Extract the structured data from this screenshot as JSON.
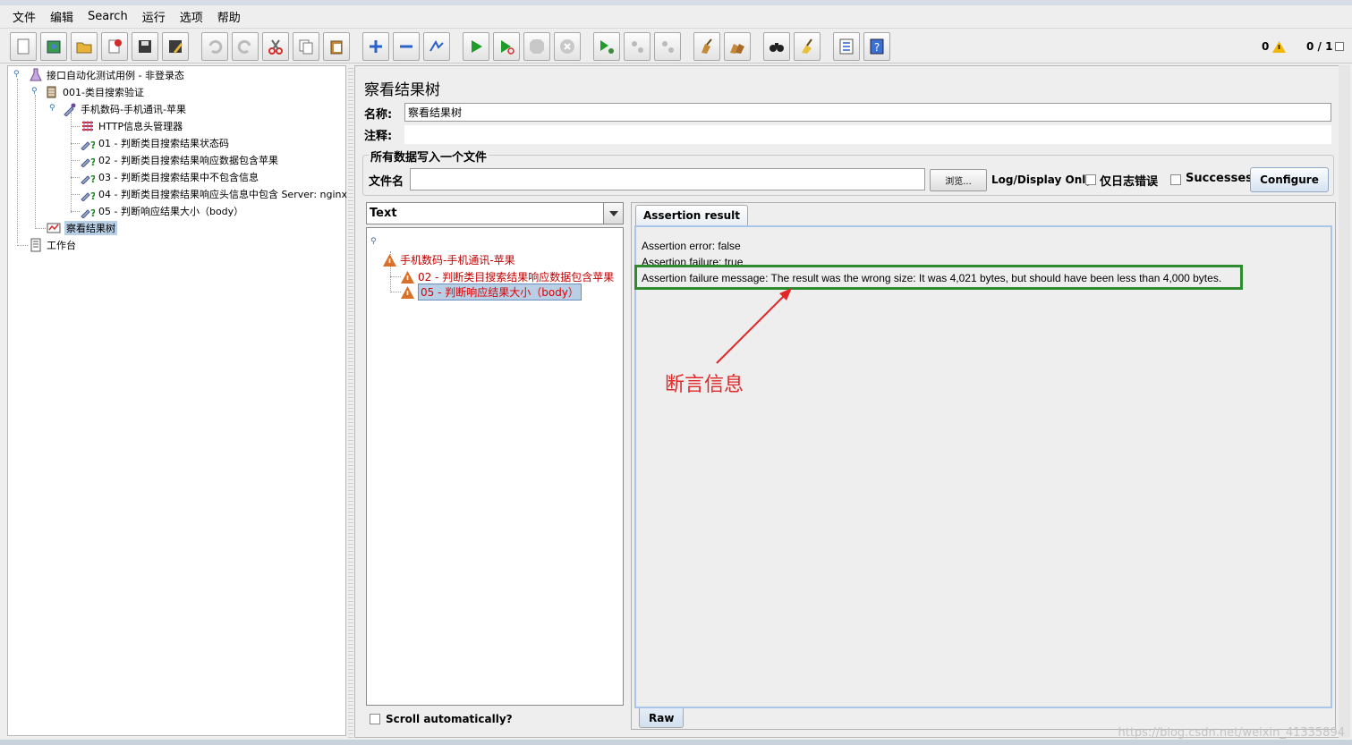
{
  "menu": [
    "文件",
    "编辑",
    "Search",
    "运行",
    "选项",
    "帮助"
  ],
  "toolbar_status": {
    "warnings": "0",
    "threads": "0 / 1"
  },
  "tree": {
    "root": "接口自动化测试用例 - 非登录态",
    "group": "001-类目搜索验证",
    "sampler": "手机数码-手机通讯-苹果",
    "items": [
      "HTTP信息头管理器",
      "01 - 判断类目搜索结果状态码",
      "02 - 判断类目搜索结果响应数据包含苹果",
      "03 - 判断类目搜索结果中不包含信息",
      "04 - 判断类目搜索结果响应头信息中包含 Server: nginx",
      "05 - 判断响应结果大小（body）"
    ],
    "listener": "察看结果树",
    "workbench": "工作台"
  },
  "panel": {
    "title": "察看结果树",
    "name_label": "名称:",
    "name_value": "察看结果树",
    "comment_label": "注释:",
    "file_group_label": "所有数据写入一个文件",
    "file_label": "文件名",
    "browse_label": "浏览...",
    "log_display_label": "Log/Display Only:",
    "errors_only_label": "仅日志错误",
    "successes_label": "Successes",
    "configure_label": "Configure"
  },
  "results": {
    "renderer": "Text",
    "root": "手机数码-手机通讯-苹果",
    "children": [
      "02 - 判断类目搜索结果响应数据包含苹果",
      "05 - 判断响应结果大小（body）"
    ],
    "scroll_label": "Scroll automatically?"
  },
  "assertion": {
    "tab": "Assertion result",
    "lines": [
      "Assertion error: false",
      "Assertion failure: true",
      "Assertion failure message: The result was the wrong size: It was 4,021 bytes, but should have been less than 4,000 bytes."
    ],
    "raw_tab": "Raw",
    "annotation": "断言信息"
  },
  "watermark": "https://blog.csdn.net/weixin_41335894",
  "colors": {
    "error_red": "#c00000",
    "highlight_green": "#2e8b2e",
    "annotation_red": "#e02828",
    "selection": "#b8cfe5"
  }
}
